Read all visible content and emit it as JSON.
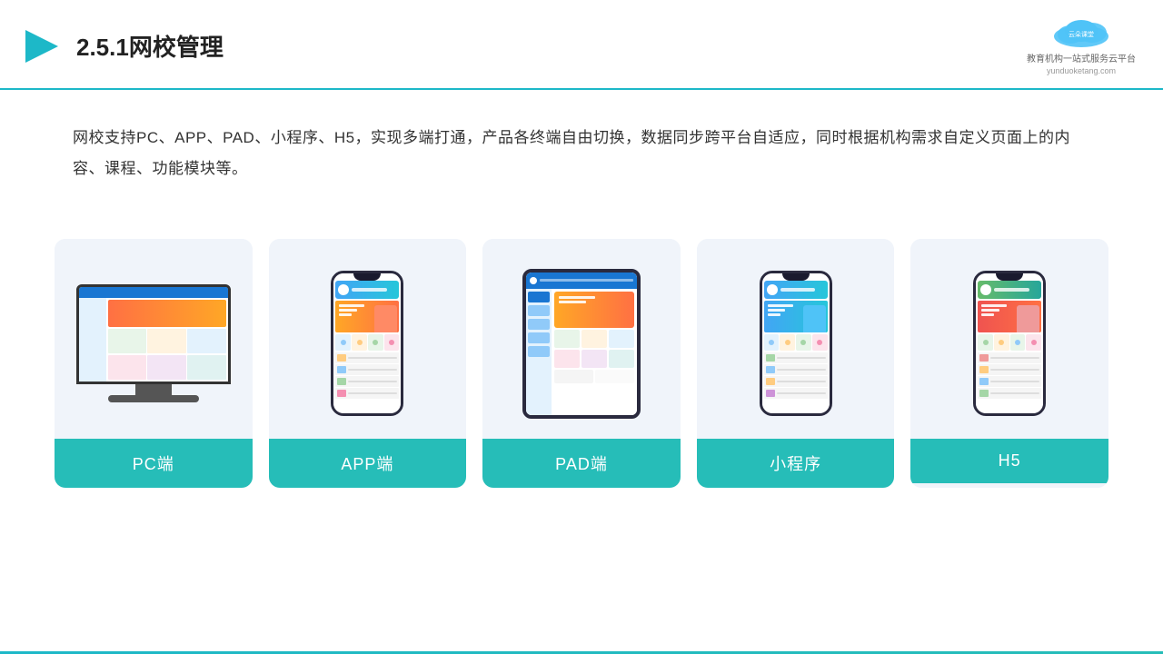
{
  "header": {
    "title": "2.5.1网校管理",
    "logo_name": "云朵课堂",
    "logo_sub": "yunduoketang.com",
    "logo_tagline": "教育机构一站\n式服务云平台"
  },
  "description": {
    "text": "网校支持PC、APP、PAD、小程序、H5，实现多端打通，产品各终端自由切换，数据同步跨平台自适应，同时根据机构需求自定义页面上的内容、课程、功能模块等。"
  },
  "cards": [
    {
      "id": "pc",
      "label": "PC端"
    },
    {
      "id": "app",
      "label": "APP端"
    },
    {
      "id": "pad",
      "label": "PAD端"
    },
    {
      "id": "miniprogram",
      "label": "小程序"
    },
    {
      "id": "h5",
      "label": "H5"
    }
  ],
  "colors": {
    "accent": "#26bdb8",
    "border": "#1db8c8",
    "card_bg": "#f0f4fa",
    "label_bg": "#26bdb8",
    "label_text": "#ffffff"
  }
}
